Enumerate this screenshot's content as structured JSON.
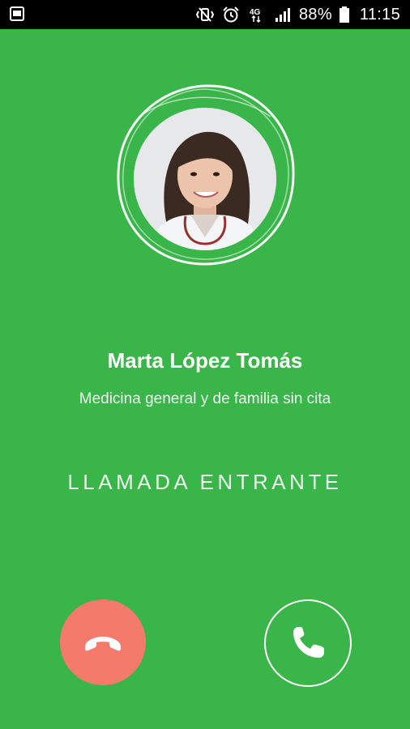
{
  "status_bar": {
    "battery_percent": "88%",
    "time": "11:15",
    "network_label": "4G",
    "icons": [
      "image-notification-icon",
      "vibrate-icon",
      "alarm-icon",
      "network-4g-icon",
      "signal-icon",
      "battery-icon"
    ]
  },
  "caller": {
    "name": "Marta López Tomás",
    "specialty": "Medicina general y de familia sin cita",
    "avatar_icon": "doctor-avatar"
  },
  "call": {
    "status": "LLAMADA ENTRANTE",
    "decline_icon": "hang-up-icon",
    "accept_icon": "phone-icon"
  },
  "colors": {
    "background": "#3ab54a",
    "decline": "#f47b6c",
    "status_bar": "#000000",
    "text": "#ffffff"
  }
}
